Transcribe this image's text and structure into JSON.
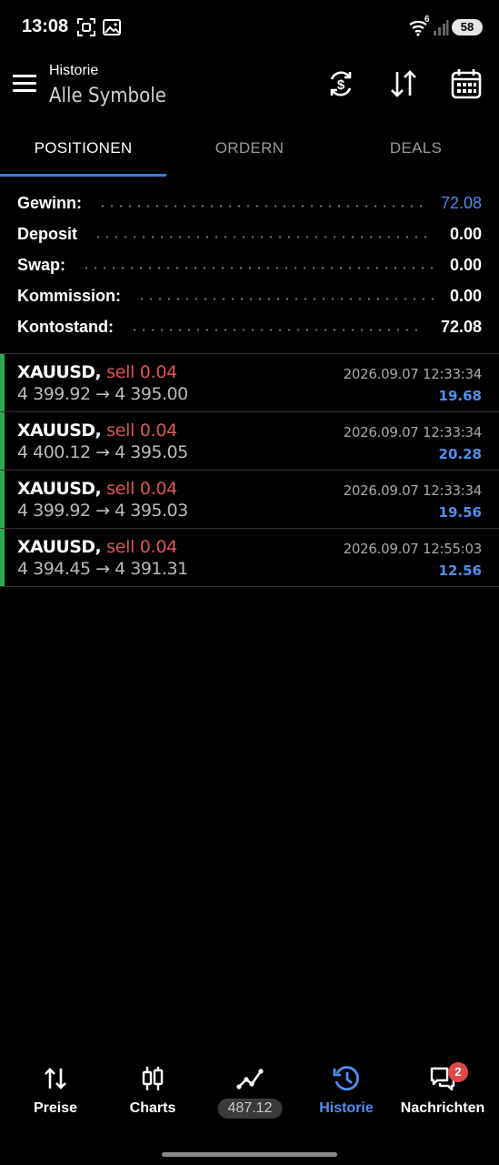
{
  "status_bar": {
    "time": "13:08",
    "wifi_label": "6",
    "battery": "58",
    "icons": [
      "screenshot-icon",
      "image-icon",
      "wifi-icon",
      "signal-icon",
      "battery-icon"
    ]
  },
  "header": {
    "subtitle": "Historie",
    "title": "Alle Symbole",
    "actions": [
      "currency-exchange-icon",
      "sort-icon",
      "calendar-icon"
    ]
  },
  "tabs": [
    {
      "label": "POSITIONEN",
      "active": true
    },
    {
      "label": "ORDERN",
      "active": false
    },
    {
      "label": "DEALS",
      "active": false
    }
  ],
  "summary": [
    {
      "label": "Gewinn:",
      "value": "72.08",
      "highlight": true
    },
    {
      "label": "Deposit",
      "value": "0.00",
      "highlight": false
    },
    {
      "label": "Swap:",
      "value": "0.00",
      "highlight": false
    },
    {
      "label": "Kommission:",
      "value": "0.00",
      "highlight": false
    },
    {
      "label": "Kontostand:",
      "value": "72.08",
      "highlight": false
    }
  ],
  "deals": [
    {
      "symbol": "XAUUSD,",
      "side": "sell 0.04",
      "prices": "4 399.92 → 4 395.00",
      "time": "2026.09.07 12:33:34",
      "profit": "19.68"
    },
    {
      "symbol": "XAUUSD,",
      "side": "sell 0.04",
      "prices": "4 400.12 → 4 395.05",
      "time": "2026.09.07 12:33:34",
      "profit": "20.28"
    },
    {
      "symbol": "XAUUSD,",
      "side": "sell 0.04",
      "prices": "4 399.92 → 4 395.03",
      "time": "2026.09.07 12:33:34",
      "profit": "19.56"
    },
    {
      "symbol": "XAUUSD,",
      "side": "sell 0.04",
      "prices": "4 394.45 → 4 391.31",
      "time": "2026.09.07 12:55:03",
      "profit": "12.56"
    }
  ],
  "bottom_nav": [
    {
      "label": "Preise",
      "icon": "quotes-arrows-icon",
      "active": false
    },
    {
      "label": "Charts",
      "icon": "candlestick-icon",
      "active": false
    },
    {
      "label": "487.12",
      "icon": "trade-line-icon",
      "active": false
    },
    {
      "label": "Historie",
      "icon": "history-clock-icon",
      "active": true
    },
    {
      "label": "Nachrichten",
      "icon": "messages-icon",
      "active": false,
      "badge": "2"
    }
  ],
  "colors": {
    "accent": "#4f8ef0",
    "sell": "#e05454",
    "deal_bar": "#2fa84f",
    "background": "#000000"
  }
}
